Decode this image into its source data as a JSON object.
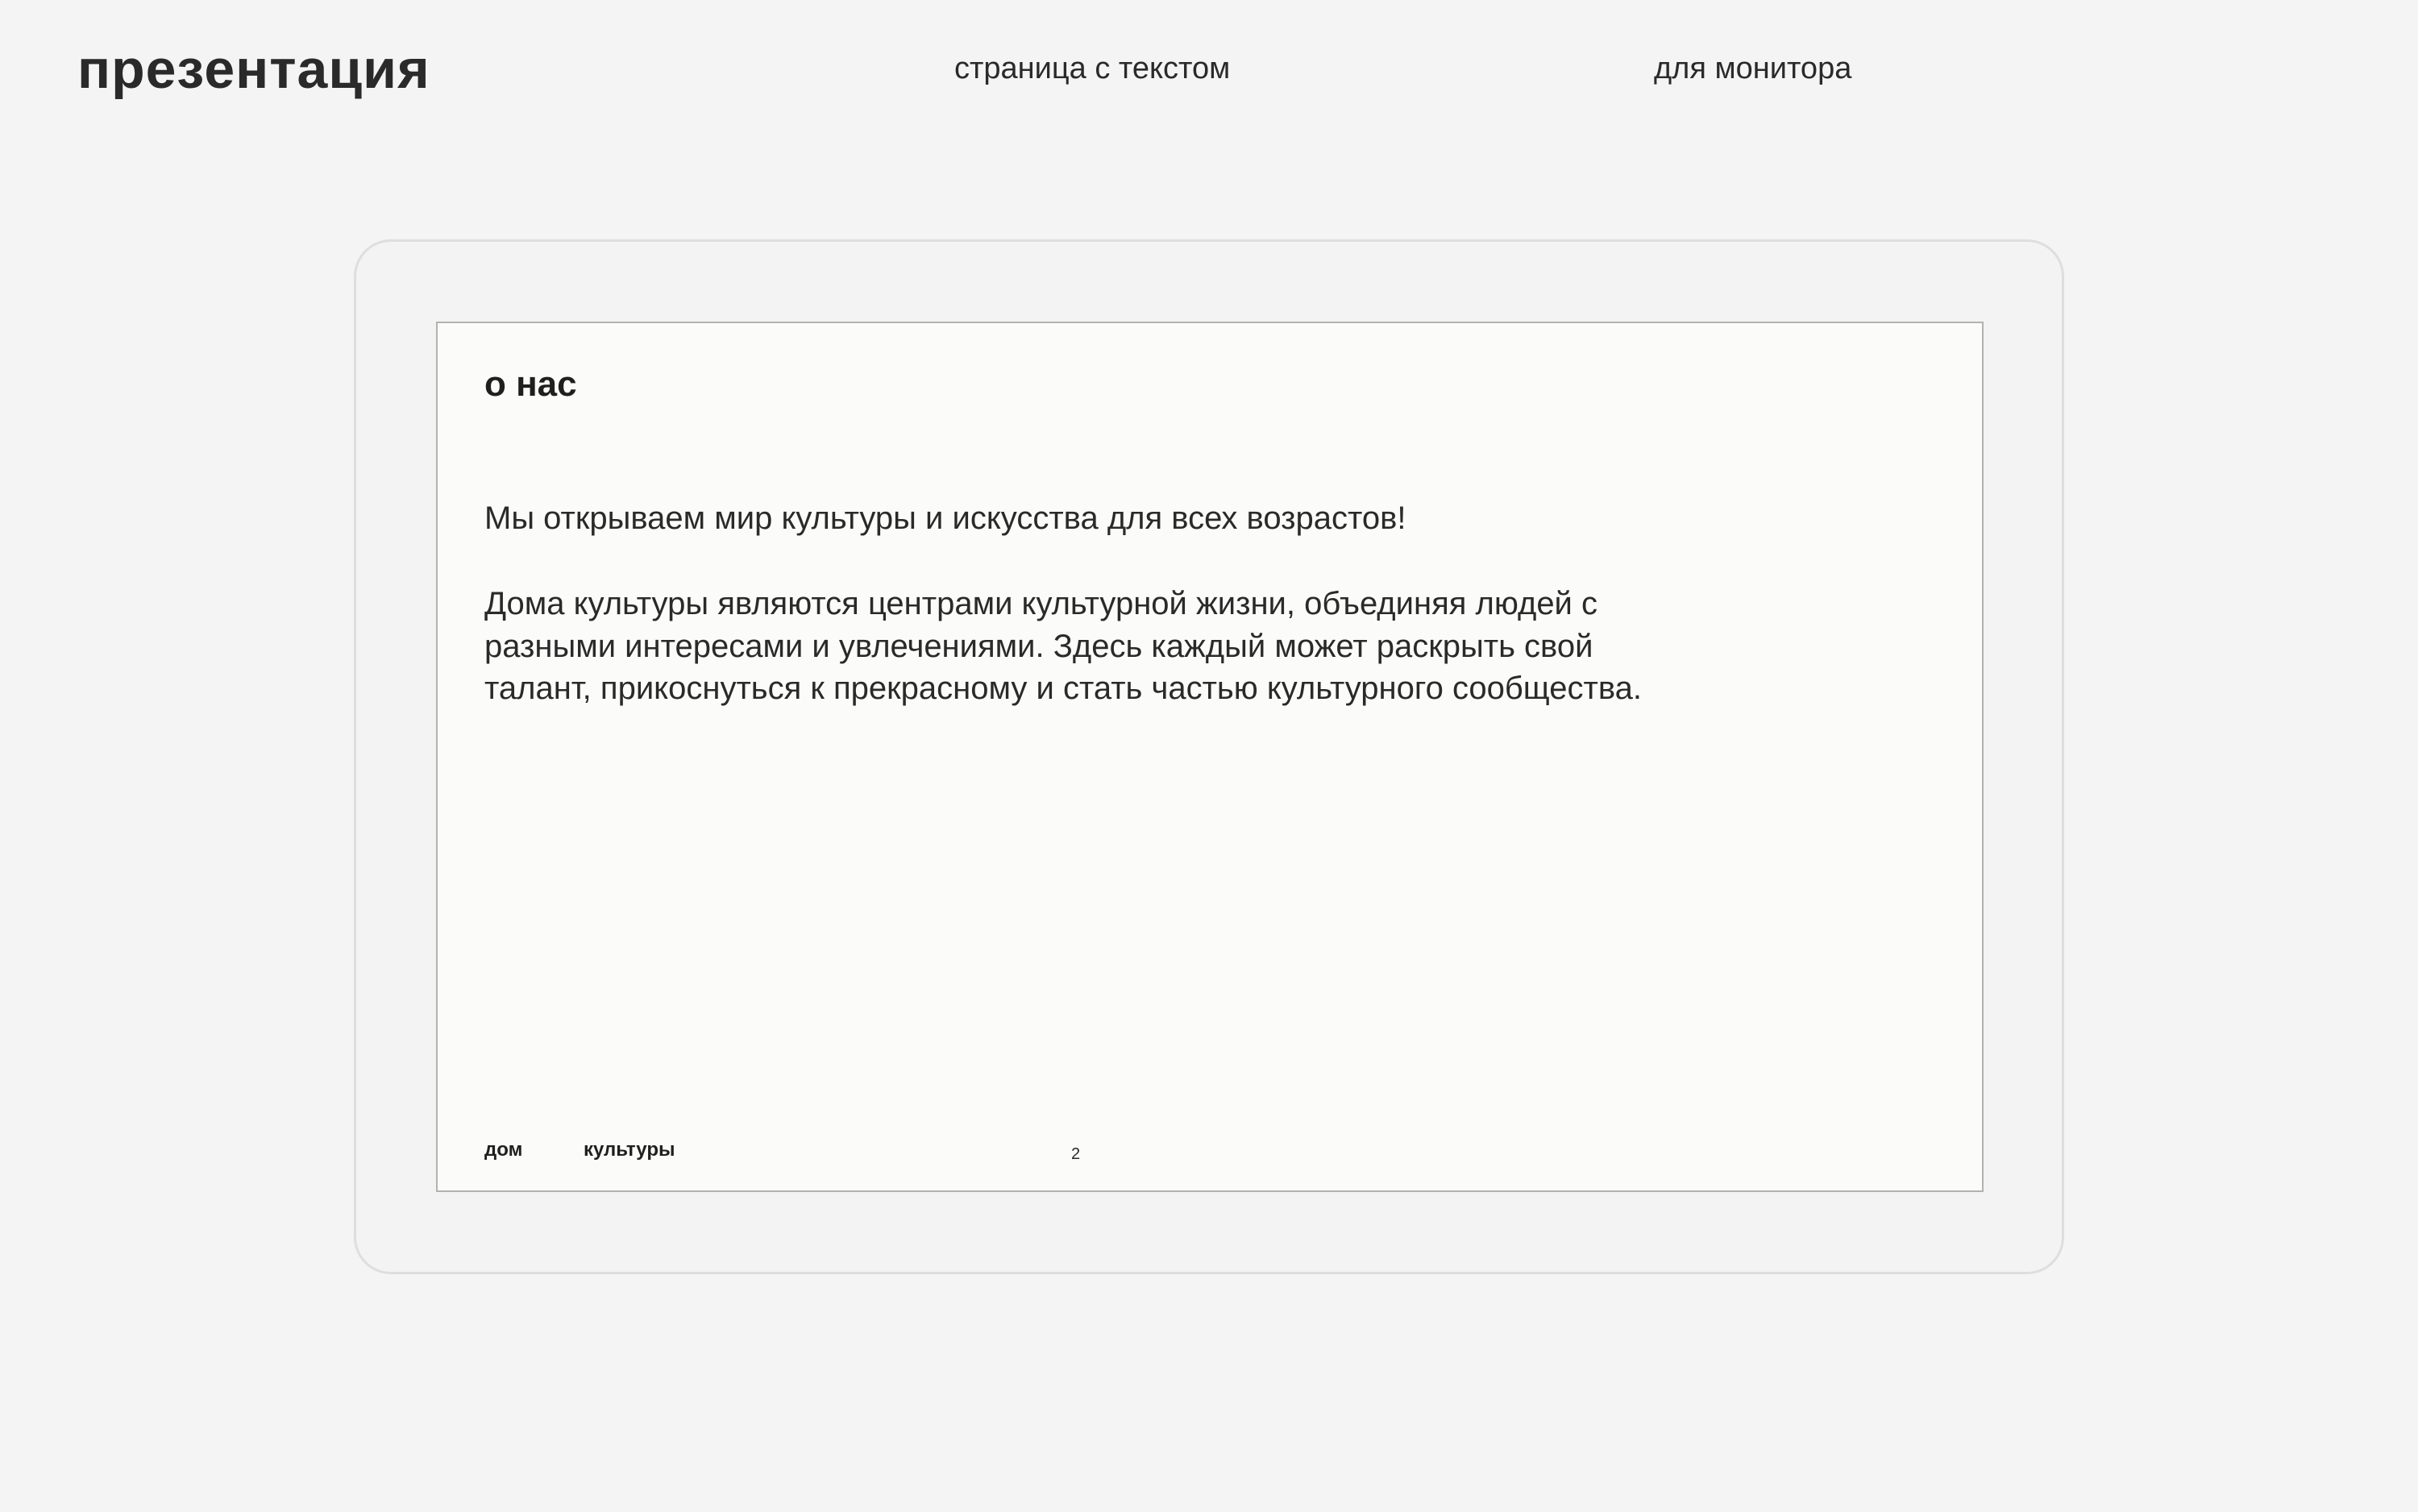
{
  "header": {
    "title": "презентация",
    "subtitle_page": "страница с текстом",
    "subtitle_device": "для монитора"
  },
  "slide": {
    "heading": "о нас",
    "lead": "Мы открываем мир культуры и искусства для всех возрастов!",
    "body": "Дома культуры являются центрами культурной жизни, объединяя людей с разными интересами и увлечениями. Здесь каждый может раскрыть свой талант, прикоснуться к прекрасному и стать частью культурного сообщества.",
    "footer": {
      "left": "дом",
      "right": "культуры",
      "page_number": "2"
    }
  },
  "colors": {
    "background": "#f4f4f4",
    "frame_border": "#dedede",
    "screen_background": "#fbfbf9",
    "screen_border": "#b2b2b2",
    "text": "#2a2a2a"
  }
}
